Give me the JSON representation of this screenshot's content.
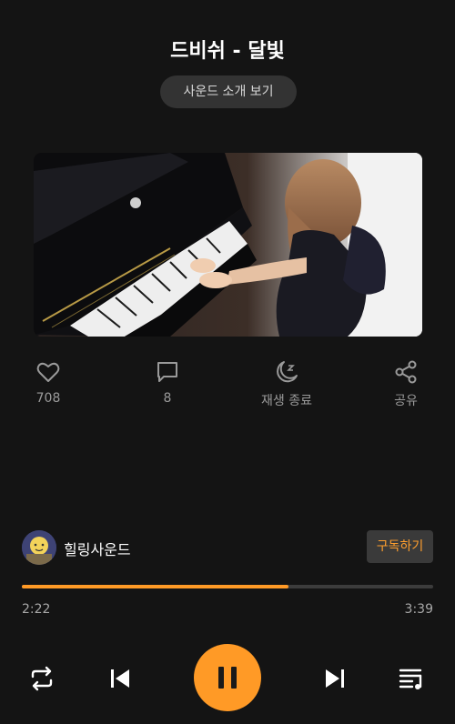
{
  "track": {
    "title": "드비쉬 - 달빛"
  },
  "intro_button": {
    "label": "사운드 소개 보기"
  },
  "actions": [
    {
      "id": "like",
      "icon": "heart-icon",
      "label": "708"
    },
    {
      "id": "comment",
      "icon": "comment-icon",
      "label": "8"
    },
    {
      "id": "sleep",
      "icon": "moon-zz-icon",
      "label": "재생 종료"
    },
    {
      "id": "share",
      "icon": "share-icon",
      "label": "공유"
    }
  ],
  "channel": {
    "name": "힐링사운드",
    "subscribe_label": "구독하기"
  },
  "player": {
    "current_time": "2:22",
    "total_time": "3:39",
    "progress_fraction": 0.648,
    "accent_color": "#ff9a26"
  },
  "controls": [
    {
      "id": "repeat",
      "icon": "repeat-icon"
    },
    {
      "id": "previous",
      "icon": "skip-previous-icon"
    },
    {
      "id": "pause",
      "icon": "pause-icon"
    },
    {
      "id": "next",
      "icon": "skip-next-icon"
    },
    {
      "id": "playlist",
      "icon": "playlist-icon"
    }
  ]
}
